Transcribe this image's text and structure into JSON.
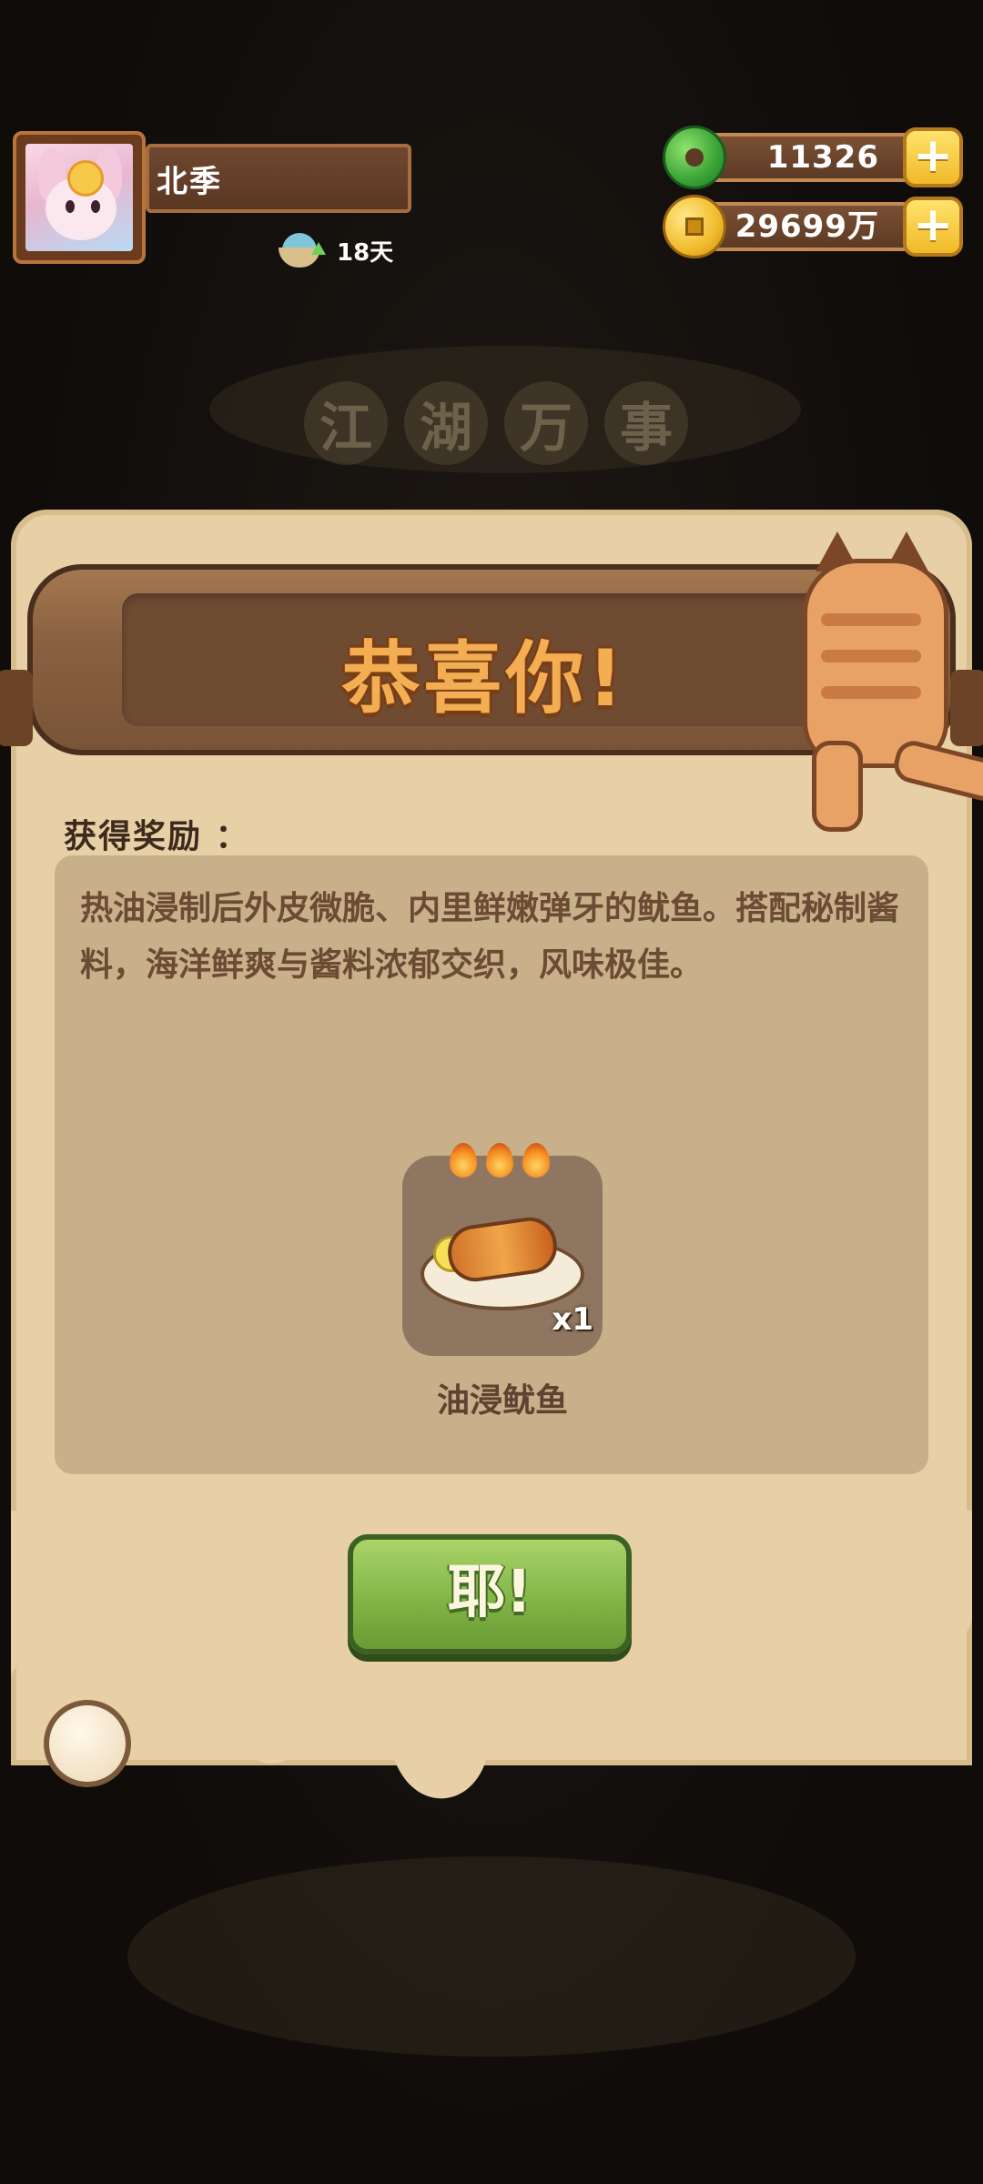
{
  "player": {
    "name": "北季",
    "days_label": "18天"
  },
  "resources": {
    "jade": "11326",
    "coins": "29699万",
    "plus_symbol": "+"
  },
  "background": {
    "title_chars": [
      "江",
      "湖",
      "万",
      "事"
    ]
  },
  "popup": {
    "title": "恭喜你!",
    "reward_label": "获得奖励 ：",
    "description": "热油浸制后外皮微脆、内里鲜嫩弹牙的鱿鱼。搭配秘制酱料，海洋鲜爽与酱料浓郁交织，风味极佳。",
    "item": {
      "name": "油浸鱿鱼",
      "quantity": "x1",
      "flame_count": 3
    },
    "confirm_button": "耶!"
  },
  "colors": {
    "title_orange": "#f3ae53",
    "paper": "#e7cfa6",
    "button_green": "#7fb243"
  }
}
